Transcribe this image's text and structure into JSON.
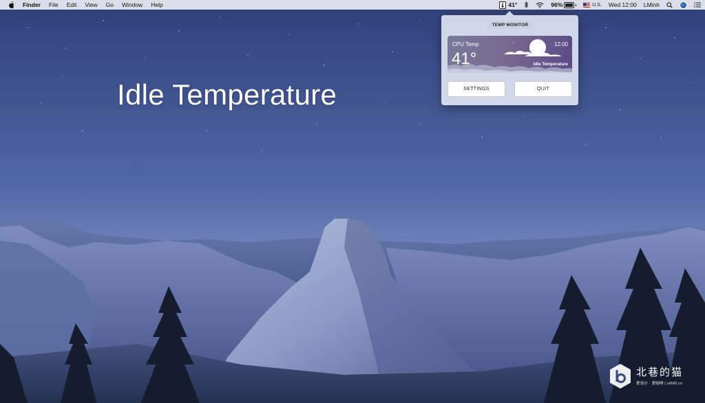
{
  "menubar": {
    "app_name": "Finder",
    "menus": [
      "File",
      "Edit",
      "View",
      "Go",
      "Window",
      "Help"
    ],
    "status": {
      "temperature": "41°",
      "battery_percent": "96%",
      "battery_level": 0.96,
      "input_source": "U.S.",
      "clock": "Wed 12:00",
      "user": "LMinh"
    }
  },
  "desktop": {
    "title": "Idle Temperature"
  },
  "popover": {
    "header": "TEMP MONITOR",
    "widget": {
      "label": "CPU Temp",
      "value": "41°",
      "time": "12:00",
      "status": "Idle Temperature"
    },
    "buttons": {
      "settings": "SETTINGS",
      "quit": "QUIT"
    }
  },
  "watermark": {
    "title": "北巷的猫",
    "subtitle": "爱设计 · 爱咖啡 | ui666.cn"
  },
  "colors": {
    "sky_top": "#2f3f78",
    "sky_bottom": "#7d8fc4",
    "popover_bg": "#dbe2f0",
    "widget_accent": "#5a4a86"
  }
}
